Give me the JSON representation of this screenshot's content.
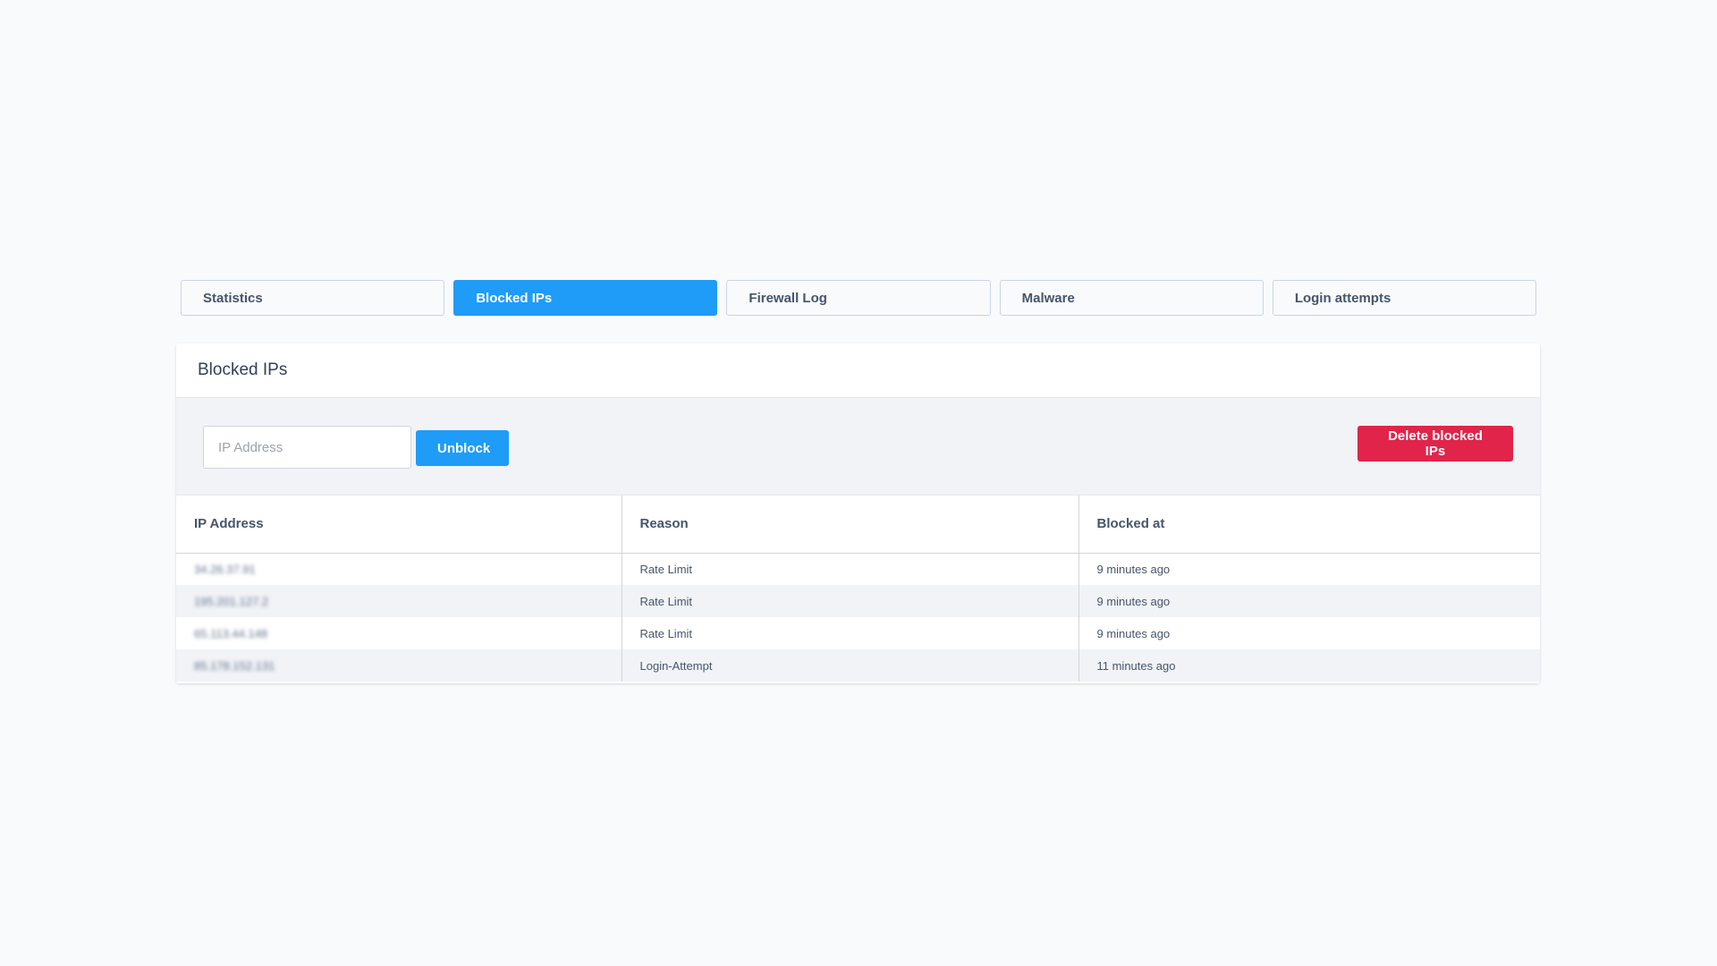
{
  "tabs": [
    {
      "label": "Statistics",
      "active": false
    },
    {
      "label": "Blocked IPs",
      "active": true
    },
    {
      "label": "Firewall Log",
      "active": false
    },
    {
      "label": "Malware",
      "active": false
    },
    {
      "label": "Login attempts",
      "active": false
    }
  ],
  "card": {
    "title": "Blocked IPs"
  },
  "toolbar": {
    "ip_input_placeholder": "IP Address",
    "ip_input_value": "",
    "unblock_label": "Unblock",
    "delete_label": "Delete blocked IPs"
  },
  "table": {
    "headers": [
      "IP Address",
      "Reason",
      "Blocked at"
    ],
    "rows": [
      {
        "ip": "34.26.37.91",
        "reason": "Rate Limit",
        "blocked_at": "9 minutes ago"
      },
      {
        "ip": "195.201.127.2",
        "reason": "Rate Limit",
        "blocked_at": "9 minutes ago"
      },
      {
        "ip": "65.113.44.148",
        "reason": "Rate Limit",
        "blocked_at": "9 minutes ago"
      },
      {
        "ip": "85.178.152.131",
        "reason": "Login-Attempt",
        "blocked_at": "11 minutes ago"
      }
    ]
  },
  "colors": {
    "accent": "#1e9cf8",
    "danger": "#e0244a",
    "background": "#f8fafc",
    "toolbar_bg": "#f1f3f6"
  }
}
